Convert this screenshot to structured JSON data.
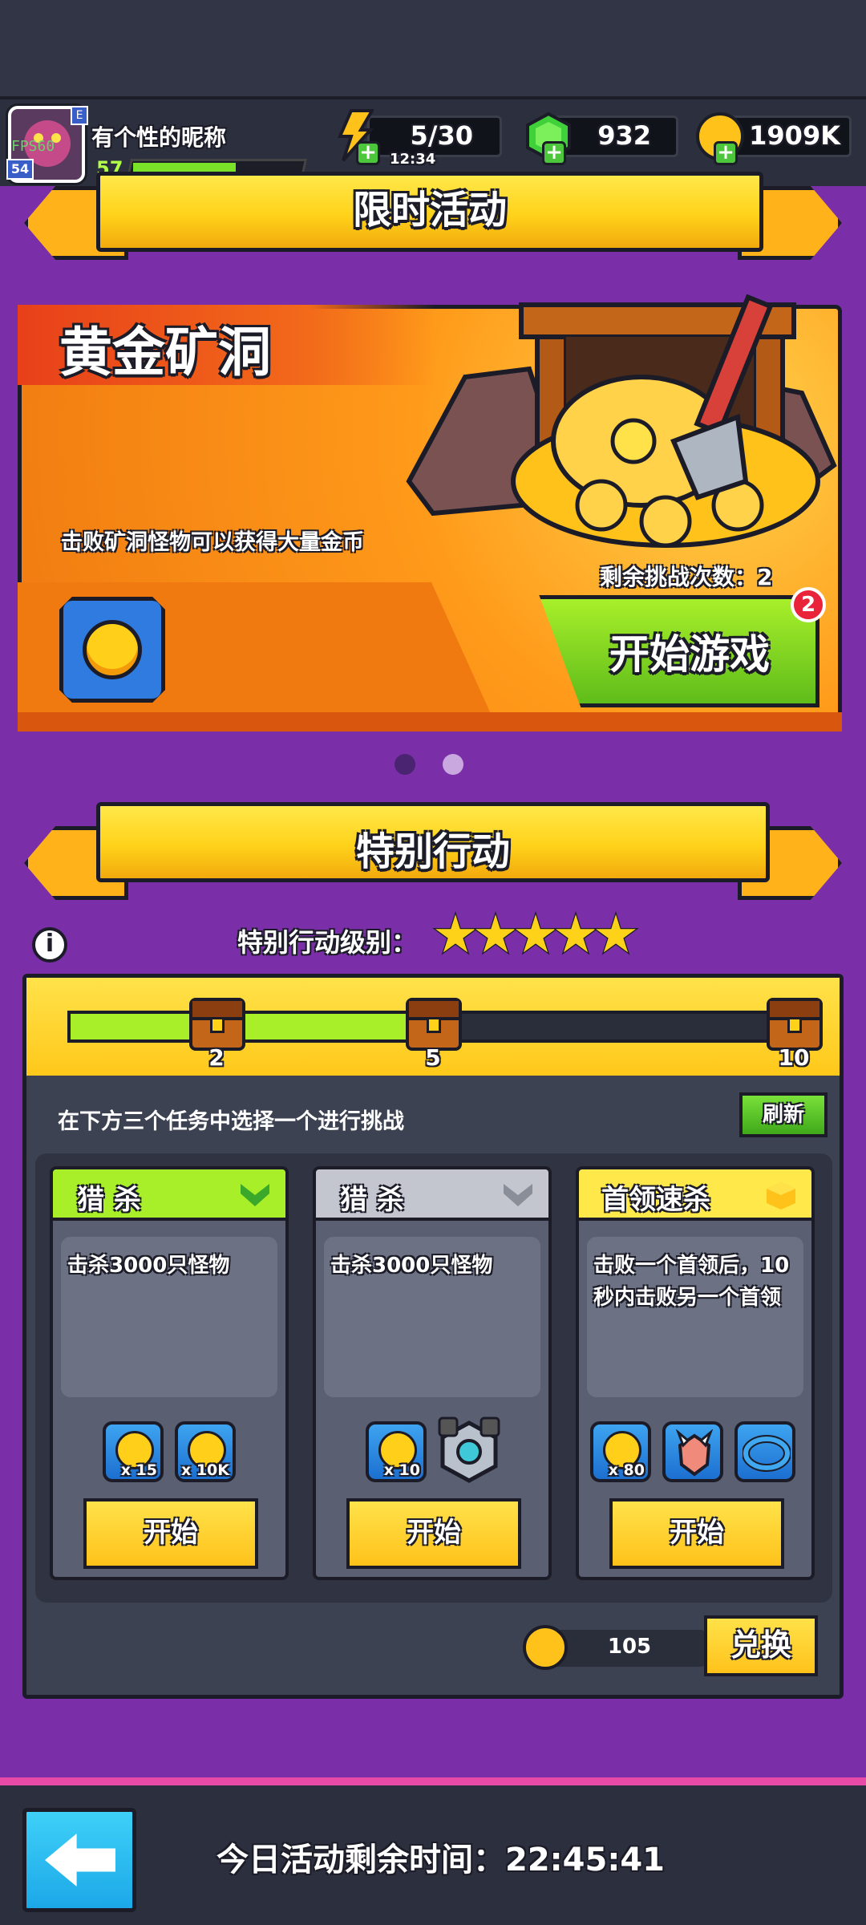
{
  "player": {
    "name": "有个性的昵称",
    "level": "57",
    "avatar_tag": "FPS60",
    "avatar_level_badge": "54",
    "vip_badge": "E",
    "xp_fraction": 0.58
  },
  "resources": {
    "energy": "5/30",
    "energy_timer": "12:34",
    "gems": "932",
    "coins": "1909K"
  },
  "limited_event": {
    "ribbon_title": "限时活动",
    "name": "黄金矿洞",
    "description": "击败矿洞怪物可以获得大量金币",
    "remaining_label": "剩余挑战次数：2",
    "start_button": "开始游戏",
    "badge_count": "2",
    "page_indicator": {
      "count": 2,
      "active_index": 1
    }
  },
  "special_action": {
    "ribbon_title": "特别行动",
    "level_label": "特别行动级别：",
    "stars": 5,
    "progress_milestones": [
      "2",
      "5",
      "10"
    ],
    "progress_fraction": 0.46,
    "instruction": "在下方三个任务中选择一个进行挑战",
    "refresh_button": "刷新",
    "tasks": [
      {
        "title": "猎 杀",
        "header_color": "#a8ef2a",
        "description": "击杀3000只怪物",
        "rewards": [
          {
            "icon": "coin-icon",
            "qty": "x 15"
          },
          {
            "icon": "coin-icon",
            "qty": "x 10K"
          }
        ],
        "start_button": "开始"
      },
      {
        "title": "猎 杀",
        "header_color": "#c3c6cf",
        "description": "击杀3000只怪物",
        "rewards": [
          {
            "icon": "coin-icon",
            "qty": "x 10"
          },
          {
            "icon": "gear-part-icon",
            "qty": ""
          }
        ],
        "start_button": "开始"
      },
      {
        "title": "首领速杀",
        "header_color": "#ffe84a",
        "description": "击败一个首领后，10秒内击败另一个首领",
        "rewards": [
          {
            "icon": "coin-icon",
            "qty": "x 80"
          },
          {
            "icon": "claw-icon",
            "qty": ""
          },
          {
            "icon": "bracelet-icon",
            "qty": ""
          }
        ],
        "start_button": "开始"
      }
    ],
    "token_value": "105",
    "exchange_button": "兑换"
  },
  "bottom": {
    "remaining_time": "今日活动剩余时间：22:45:41"
  }
}
